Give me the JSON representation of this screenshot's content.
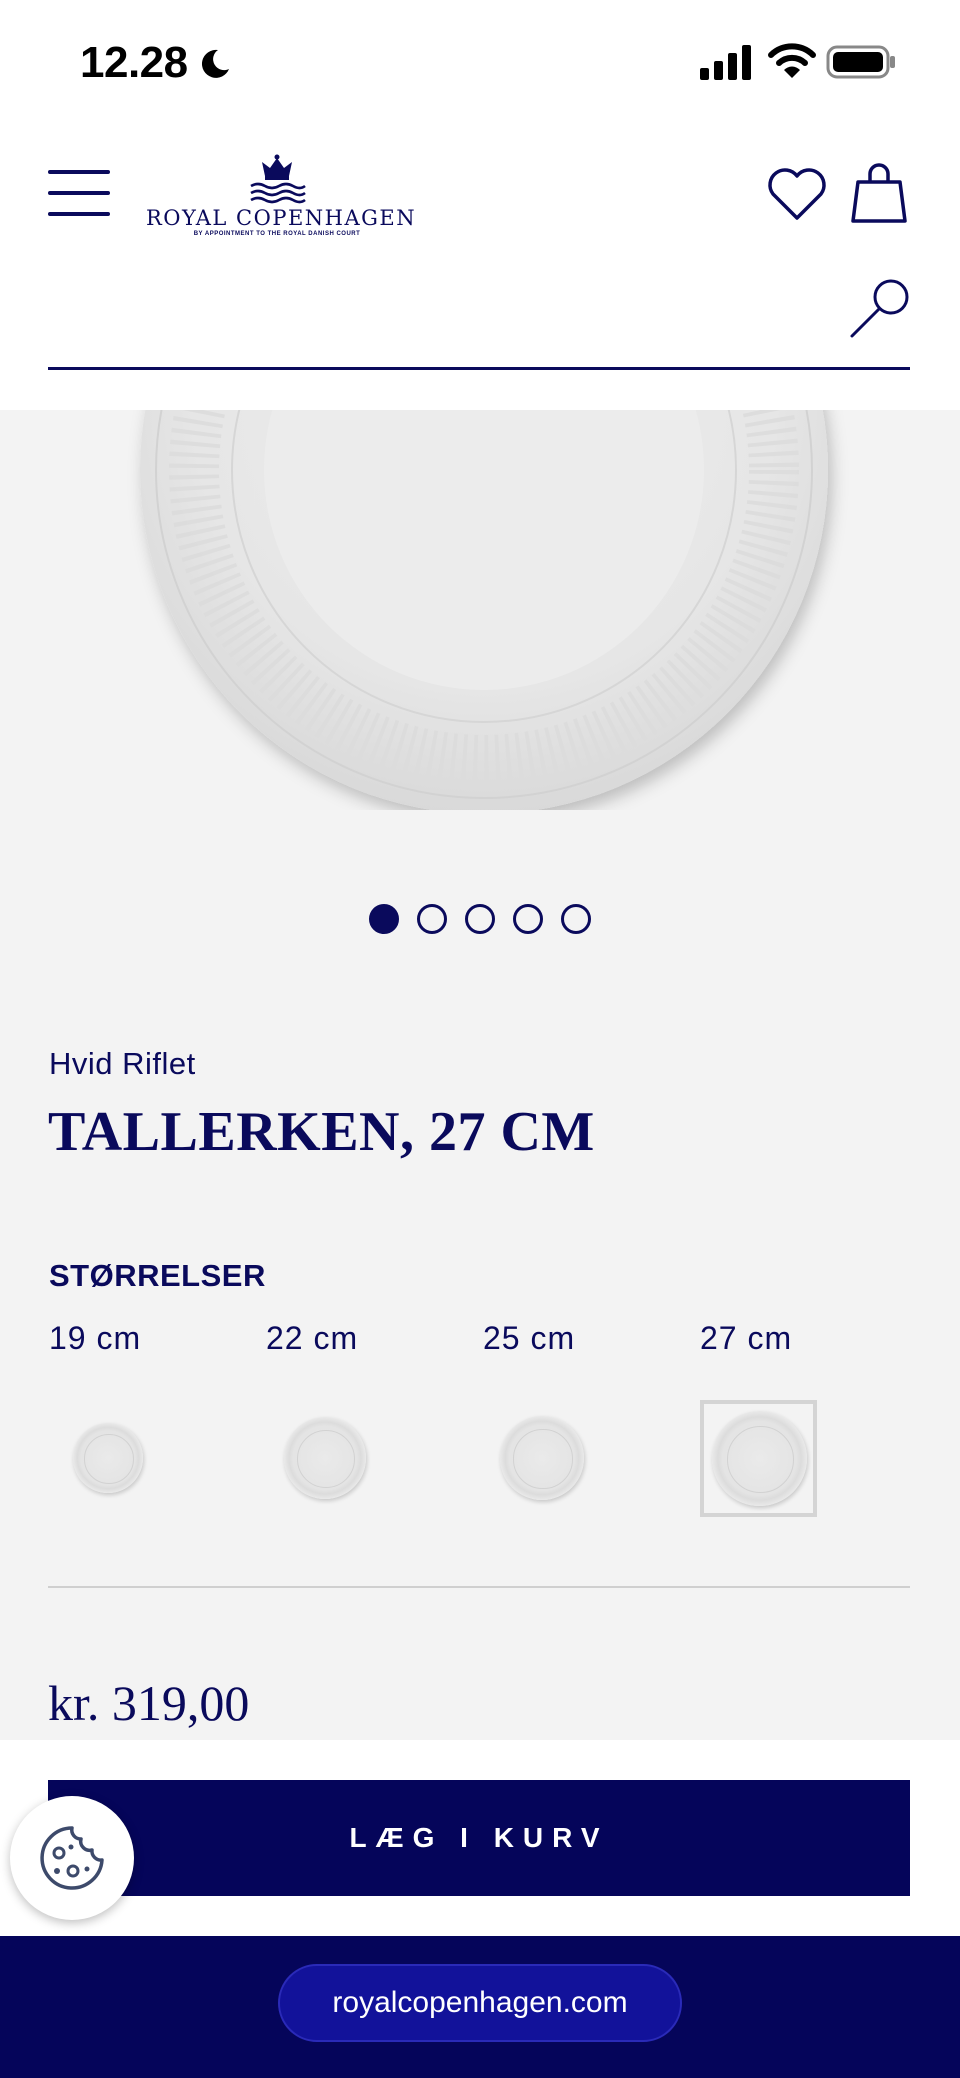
{
  "status_bar": {
    "time": "12.28",
    "icons": [
      "moon-icon",
      "signal-icon",
      "wifi-icon",
      "battery-icon"
    ]
  },
  "header": {
    "logo_text": "ROYAL COPENHAGEN",
    "logo_subtext": "BY APPOINTMENT TO THE ROYAL DANISH COURT",
    "icons": [
      "menu-icon",
      "heart-icon",
      "bag-icon"
    ],
    "search_value": "",
    "search_placeholder": ""
  },
  "gallery": {
    "image_count": 5,
    "active_index": 0
  },
  "product": {
    "collection": "Hvid Riflet",
    "title": "TALLERKEN, 27 CM",
    "sizes_heading": "STØRRELSER",
    "sizes": [
      {
        "label": "19 cm",
        "selected": false
      },
      {
        "label": "22 cm",
        "selected": false
      },
      {
        "label": "25 cm",
        "selected": false
      },
      {
        "label": "27 cm",
        "selected": true
      }
    ],
    "price": "kr. 319,00",
    "add_to_cart_label": "LÆG I KURV"
  },
  "browser": {
    "url": "royalcopenhagen.com"
  },
  "colors": {
    "brand_navy": "#05055a",
    "text_navy": "#0a0a5c",
    "gallery_bg": "#f3f3f3"
  }
}
